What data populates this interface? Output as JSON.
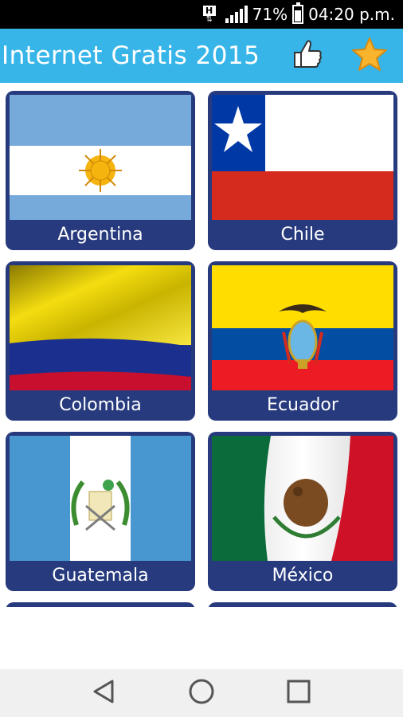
{
  "status_bar": {
    "network_badge": "H",
    "battery": "71%",
    "time": "04:20 p.m."
  },
  "app_bar": {
    "title": "Internet Gratis 2015",
    "like_icon": "thumbs-up-icon",
    "favorite_icon": "star-icon"
  },
  "countries": [
    {
      "name": "Argentina"
    },
    {
      "name": "Chile"
    },
    {
      "name": "Colombia"
    },
    {
      "name": "Ecuador"
    },
    {
      "name": "Guatemala"
    },
    {
      "name": "México"
    }
  ],
  "colors": {
    "app_bar": "#37b5e9",
    "card": "#273a7e",
    "status_bar": "#000000"
  },
  "nav_bar": {
    "back_icon": "back-triangle-icon",
    "home_icon": "home-circle-icon",
    "recents_icon": "recents-square-icon"
  }
}
